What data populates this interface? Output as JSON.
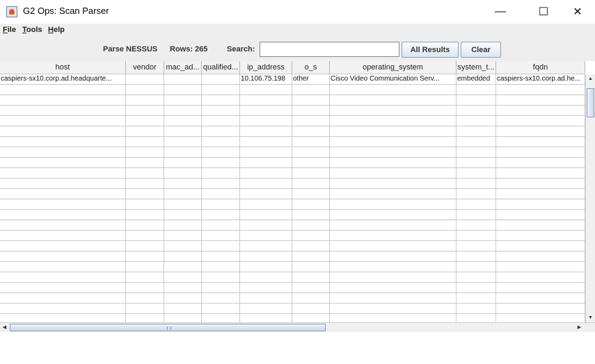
{
  "window": {
    "title": "G2 Ops: Scan Parser",
    "controls": [
      "—",
      "☐",
      "✕"
    ]
  },
  "menubar": {
    "items": [
      {
        "underline": "F",
        "rest": "ile"
      },
      {
        "underline": "T",
        "rest": "ools"
      },
      {
        "underline": "H",
        "rest": "elp"
      }
    ]
  },
  "toolbar": {
    "parse_label": "Parse NESSUS",
    "rows_label": "Rows: 265",
    "search_label": "Search:",
    "search_value": "",
    "all_results_label": "All Results",
    "clear_label": "Clear"
  },
  "table": {
    "columns": [
      "host",
      "vendor",
      "mac_ad...",
      "qualified...",
      "ip_address",
      "o_s",
      "operating_system",
      "system_t...",
      "fqdn"
    ],
    "rows": [
      [
        "caspiers-sx10.corp.ad.headquarte...",
        "",
        "",
        "",
        "10.106.75.198",
        "other",
        "Cisco Video Communication Serv...",
        "embedded",
        "caspiers-sx10.corp.ad.he..."
      ]
    ]
  },
  "scrollbars": {
    "up": "▲",
    "down": "▼",
    "left": "◀",
    "right": "▶"
  }
}
